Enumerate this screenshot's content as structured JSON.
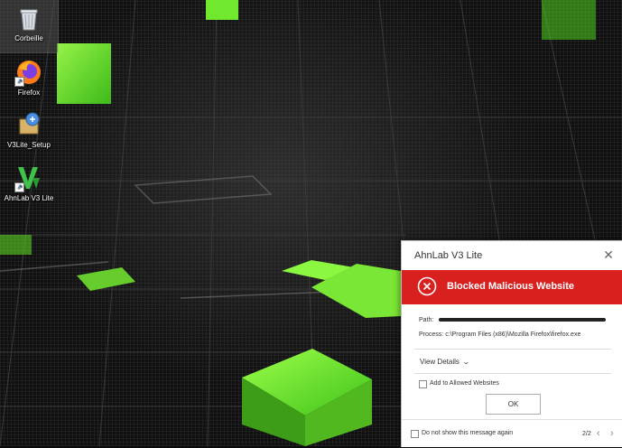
{
  "desktop": {
    "icons": [
      {
        "label": "Corbeille",
        "icon": "recycle-bin-icon"
      },
      {
        "label": "Firefox",
        "icon": "firefox-icon"
      },
      {
        "label": "V3Lite_Setup",
        "icon": "installer-icon"
      },
      {
        "label": "AhnLab V3 Lite",
        "icon": "ahnlab-v3-icon"
      }
    ]
  },
  "popup": {
    "title": "AhnLab V3 Lite",
    "alert": {
      "text": "Blocked Malicious Website",
      "color": "#d8201f"
    },
    "path_label": "Path:",
    "process_label": "Process:",
    "process_value": "c:\\Program Files (x86)\\Mozilla Firefox\\firefox.exe",
    "view_details": "View Details",
    "add_allowed": "Add to Allowed Websites",
    "ok": "OK",
    "dont_show": "Do not show this message again",
    "pager": "2/2"
  }
}
